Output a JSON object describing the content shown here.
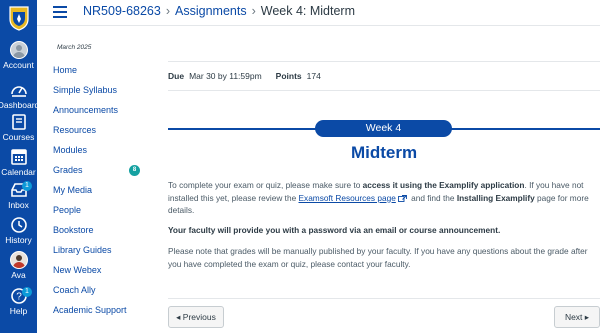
{
  "global_nav": {
    "items": [
      {
        "label": "Account",
        "icon": "user-circle-icon"
      },
      {
        "label": "Dashboard",
        "icon": "dashboard-icon"
      },
      {
        "label": "Courses",
        "icon": "book-icon"
      },
      {
        "label": "Calendar",
        "icon": "calendar-icon"
      },
      {
        "label": "Inbox",
        "icon": "inbox-icon",
        "badge": "1"
      },
      {
        "label": "History",
        "icon": "clock-icon"
      },
      {
        "label": "Ava",
        "icon": "avatar-icon"
      },
      {
        "label": "Help",
        "icon": "help-icon",
        "badge": "1"
      }
    ]
  },
  "header": {
    "breadcrumbs": [
      "NR509-68263",
      "Assignments",
      "Week 4: Midterm"
    ]
  },
  "course_nav": {
    "term": "March 2025",
    "items": [
      {
        "label": "Home"
      },
      {
        "label": "Simple Syllabus"
      },
      {
        "label": "Announcements"
      },
      {
        "label": "Resources"
      },
      {
        "label": "Modules"
      },
      {
        "label": "Grades",
        "badge": "8"
      },
      {
        "label": "My Media"
      },
      {
        "label": "People"
      },
      {
        "label": "Bookstore"
      },
      {
        "label": "Library Guides"
      },
      {
        "label": "New Webex"
      },
      {
        "label": "Coach Ally"
      },
      {
        "label": "Academic Support"
      }
    ]
  },
  "assignment": {
    "due_label": "Due",
    "due_value": "Mar 30 by 11:59pm",
    "points_label": "Points",
    "points_value": "174",
    "week_pill": "Week 4",
    "title": "Midterm",
    "p1_a": "To complete your exam or quiz, please make sure to ",
    "p1_b": "access it using the Examplify application",
    "p1_c": ". If you have not installed this yet, please review the ",
    "p1_link": "Examsoft Resources page",
    "p1_d": " and find the ",
    "p1_e": "Installing Examplify",
    "p1_f": " page for more details.",
    "p2": "Your faculty will provide you with a password via an email or course announcement.",
    "p3": "Please note that grades will be manually published by your faculty. If you have any questions about the grade after you have completed the exam or quiz, please contact your faculty."
  },
  "footer": {
    "prev_label": "◂ Previous",
    "next_label": "Next ▸"
  },
  "colors": {
    "brand": "#0b4aa6",
    "badge_blue": "#0c9ad8",
    "badge_teal": "#15a1a1"
  }
}
